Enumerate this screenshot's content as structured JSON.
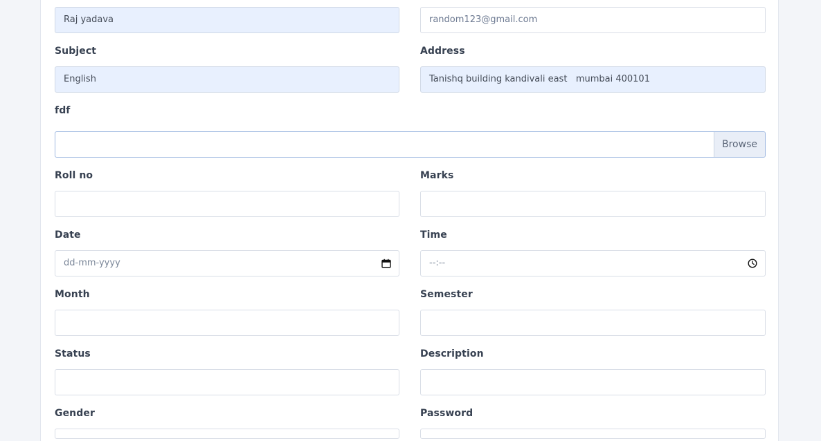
{
  "form": {
    "name": {
      "value": "Raj yadava"
    },
    "email": {
      "value": "random123@gmail.com"
    },
    "subject": {
      "label": "Subject",
      "value": "English"
    },
    "address": {
      "label": "Address",
      "value": "Tanishq building kandivali east   mumbai 400101"
    },
    "file": {
      "label": "fdf",
      "button": "Browse"
    },
    "roll_no": {
      "label": "Roll no",
      "value": ""
    },
    "marks": {
      "label": "Marks",
      "value": ""
    },
    "date": {
      "label": "Date",
      "placeholder": "dd-mm-yyyy"
    },
    "time": {
      "label": "Time",
      "placeholder": "--:--"
    },
    "month": {
      "label": "Month",
      "value": ""
    },
    "semester": {
      "label": "Semester",
      "value": ""
    },
    "status": {
      "label": "Status",
      "value": ""
    },
    "description": {
      "label": "Description",
      "value": ""
    },
    "gender": {
      "label": "Gender",
      "value": ""
    },
    "password": {
      "label": "Password",
      "value": ""
    }
  },
  "icons": {
    "date": "calendar-icon",
    "time": "clock-icon"
  },
  "colors": {
    "filled_input_bg": "#e8f0fe",
    "page_bg": "#f3f5f9",
    "label_text": "#374151"
  }
}
